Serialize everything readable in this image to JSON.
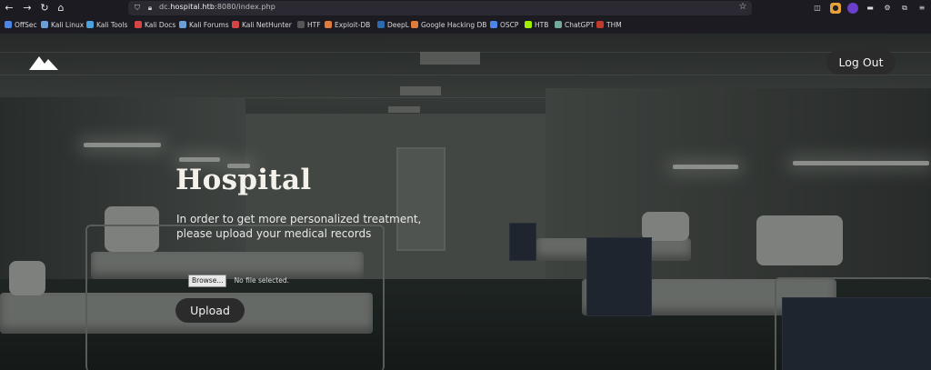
{
  "browser": {
    "url_host_prefix": "dc.",
    "url_host_main": "hospital.htb",
    "url_rest": ":8080/index.php",
    "nav_icons": [
      "back-icon",
      "forward-icon",
      "reload-icon",
      "home-icon"
    ],
    "bookmarks": [
      {
        "label": "OffSec",
        "color": "#4a86e8"
      },
      {
        "label": "Kali Linux",
        "color": "#6aa0d8"
      },
      {
        "label": "Kali Tools",
        "color": "#4aa3df"
      },
      {
        "label": "Kali Docs",
        "color": "#d64545"
      },
      {
        "label": "Kali Forums",
        "color": "#6aa0d8"
      },
      {
        "label": "Kali NetHunter",
        "color": "#d64545"
      },
      {
        "label": "HTF",
        "color": "#555555"
      },
      {
        "label": "Exploit-DB",
        "color": "#e07b39"
      },
      {
        "label": "DeepL",
        "color": "#2b6cb0"
      },
      {
        "label": "Google Hacking DB",
        "color": "#e07b39"
      },
      {
        "label": "OSCP",
        "color": "#4a86e8"
      },
      {
        "label": "HTB",
        "color": "#9fef00"
      },
      {
        "label": "ChatGPT",
        "color": "#74aa9c"
      },
      {
        "label": "THM",
        "color": "#c0392b"
      }
    ]
  },
  "header": {
    "logo_icon": "mountain-logo-icon",
    "logout_label": "Log Out"
  },
  "hero": {
    "title": "Hospital",
    "line1": "In order to get more personalized treatment,",
    "line2": "please upload your medical records"
  },
  "upload": {
    "browse_label": "Browse...",
    "file_status": "No file selected.",
    "button_label": "Upload"
  },
  "colors": {
    "button_bg": "#2a2b2a",
    "title_color": "#f4f1ea"
  }
}
